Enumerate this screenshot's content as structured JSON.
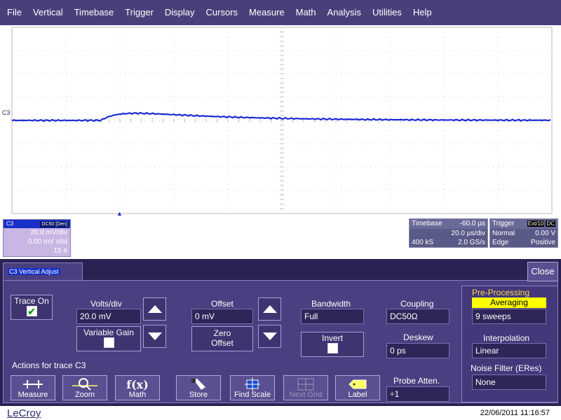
{
  "menu": [
    "File",
    "Vertical",
    "Timebase",
    "Trigger",
    "Display",
    "Cursors",
    "Measure",
    "Math",
    "Analysis",
    "Utilities",
    "Help"
  ],
  "trace": {
    "label": "C3",
    "color": "#1a2ad6"
  },
  "channel": {
    "name": "C3",
    "badge": "DC50 [Den]",
    "volts_per_div": "20.0 mV/div",
    "offset": "0.00 mV ofst",
    "sweeps": "15 #"
  },
  "timebase": {
    "title": "Timebase",
    "delay": "-60.0 µs",
    "time_per_div": "20.0 µs/div",
    "samples": "400 kS",
    "rate": "2.0 GS/s"
  },
  "trigger": {
    "title": "Trigger",
    "source": "Ext/10",
    "coupling": "DC",
    "mode": "Normal",
    "level": "0.00 V",
    "type": "Edge",
    "slope": "Positive"
  },
  "dialog": {
    "tab": "C3 Vertical Adjust",
    "close": "Close",
    "trace_on": "Trace On",
    "volts_div_label": "Volts/div",
    "volts_div_value": "20.0 mV",
    "variable_gain": "Variable Gain",
    "offset_label": "Offset",
    "offset_value": "0 mV",
    "zero_offset_1": "Zero",
    "zero_offset_2": "Offset",
    "bandwidth_label": "Bandwidth",
    "bandwidth_value": "Full",
    "invert": "Invert",
    "coupling_label": "Coupling",
    "coupling_value": "DC50Ω",
    "deskew_label": "Deskew",
    "deskew_value": "0 ps",
    "probe_label": "Probe Atten.",
    "probe_value": "÷1",
    "preproc_label": "Pre-Processing",
    "averaging": "Averaging",
    "sweeps_value": "9 sweeps",
    "interp_label": "Interpolation",
    "interp_value": "Linear",
    "noise_label": "Noise Filter (ERes)",
    "noise_value": "None",
    "actions_label": "Actions for trace C3",
    "actions": [
      {
        "label": "Measure",
        "icon": "measure-icon"
      },
      {
        "label": "Zoom",
        "icon": "zoom-icon"
      },
      {
        "label": "Math",
        "icon": "math-fx-icon"
      },
      {
        "label": "Store",
        "icon": "store-icon"
      },
      {
        "label": "Find Scale",
        "icon": "find-scale-icon"
      },
      {
        "label": "Next Grid",
        "icon": "next-grid-icon"
      },
      {
        "label": "Label",
        "icon": "label-tag-icon"
      }
    ]
  },
  "footer": {
    "brand": "LeCroy",
    "datetime": "22/06/2011 11:16:57"
  }
}
